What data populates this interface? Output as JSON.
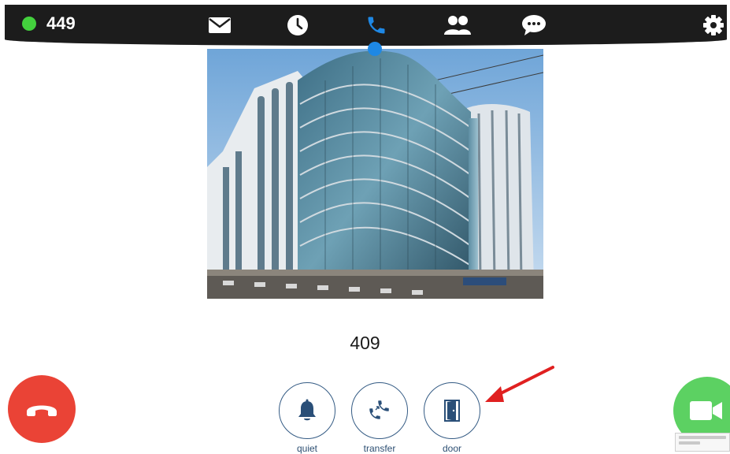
{
  "status": {
    "indicator_color": "#43d03d",
    "extension": "449"
  },
  "nav": {
    "items": [
      {
        "icon": "envelope-icon",
        "name": "messages"
      },
      {
        "icon": "clock-icon",
        "name": "history"
      },
      {
        "icon": "phone-icon",
        "name": "call",
        "active": true
      },
      {
        "icon": "contacts-icon",
        "name": "contacts"
      },
      {
        "icon": "chat-icon",
        "name": "chat"
      }
    ],
    "settings_icon": "gear-icon",
    "active_color": "#1e88e5"
  },
  "call": {
    "caller_number": "409",
    "camera_view": "building-camera-image"
  },
  "actions": [
    {
      "icon": "bell-icon",
      "label": "quiet"
    },
    {
      "icon": "transfer-icon",
      "label": "transfer"
    },
    {
      "icon": "door-icon",
      "label": "door"
    }
  ],
  "buttons": {
    "hangup_icon": "hangup-phone-icon",
    "hangup_color": "#ea4336",
    "video_icon": "video-camera-icon",
    "video_color": "#5cd162"
  },
  "annotation": {
    "arrow_color": "#e02020",
    "target": "door"
  }
}
